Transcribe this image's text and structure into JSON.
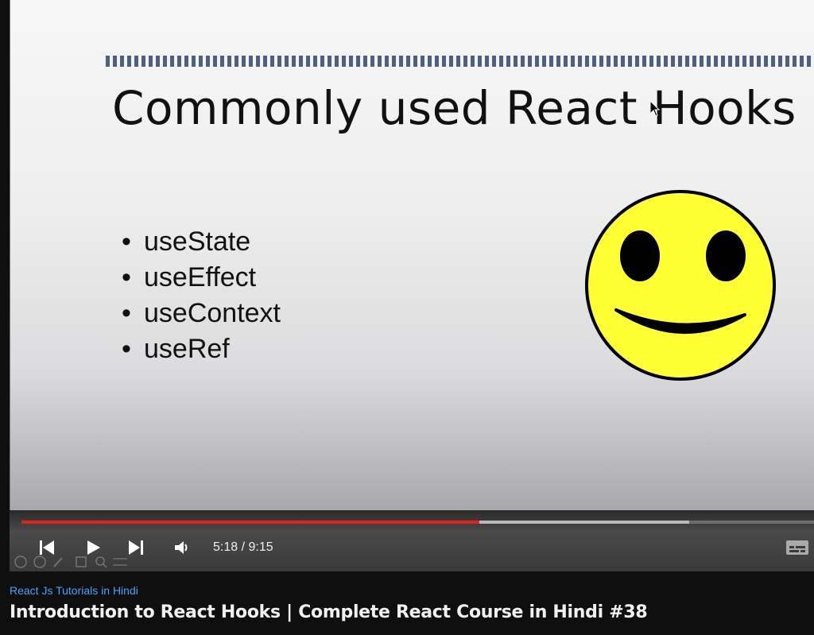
{
  "slide": {
    "title": "Commonly used React Hooks",
    "bullet": "•",
    "items": [
      "useState",
      "useEffect",
      "useContext",
      "useRef"
    ]
  },
  "player": {
    "current_time": "5:18",
    "separator": " / ",
    "duration": "9:15",
    "progress_played_percent": 57.8,
    "progress_buffered_percent": 84.3,
    "accent_color": "#e62117",
    "icons": [
      "previous-icon",
      "play-icon",
      "next-icon",
      "volume-icon",
      "subtitles-icon"
    ]
  },
  "video": {
    "channel": "React Js Tutorials in Hindi",
    "title": "Introduction to React Hooks | Complete React Course in Hindi #38"
  },
  "colors": {
    "smiley_fill": "#ffff33",
    "link": "#3ea6ff",
    "page_background": "#0f0f0f"
  }
}
